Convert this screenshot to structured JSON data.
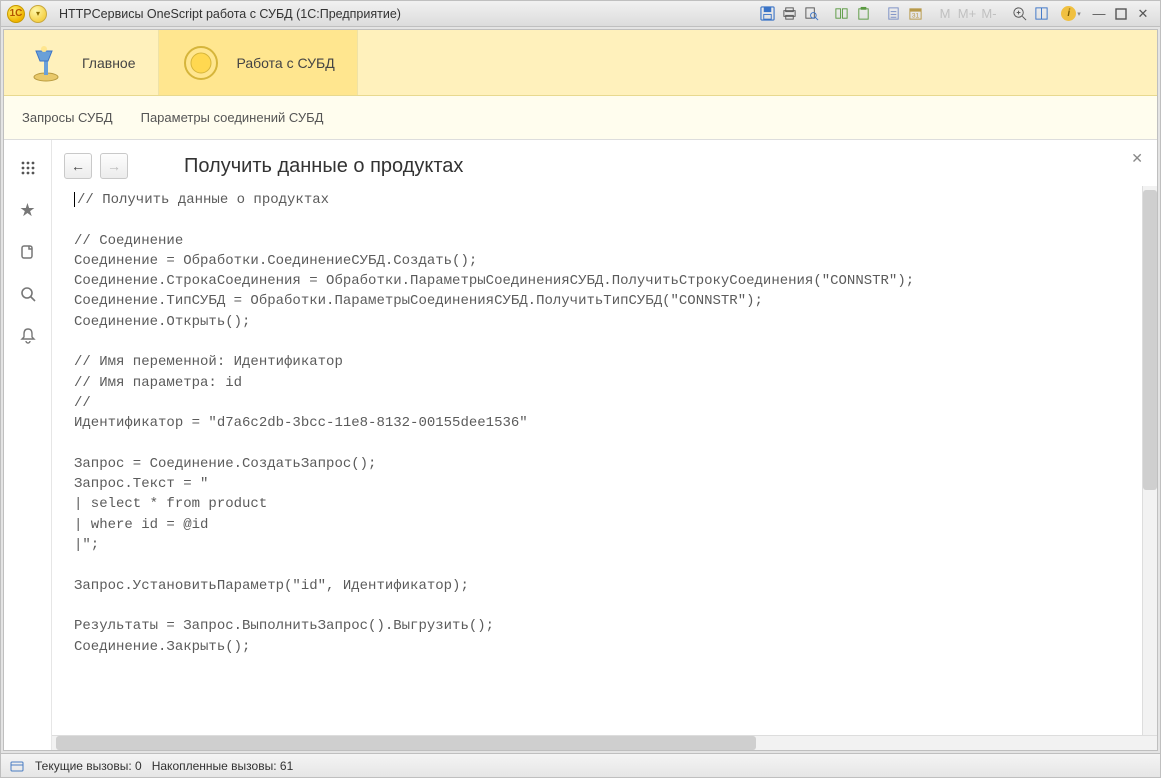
{
  "titlebar": {
    "title": "HTTPСервисы OneScript работа с СУБД  (1С:Предприятие)",
    "logo_label": "1C",
    "m_labels": [
      "M",
      "M+",
      "M-"
    ]
  },
  "tabs": [
    {
      "label": "Главное",
      "active": false
    },
    {
      "label": "Работа с СУБД",
      "active": true
    }
  ],
  "subnav": [
    "Запросы СУБД",
    "Параметры соединений СУБД"
  ],
  "document": {
    "title": "Получить данные о продуктах"
  },
  "code": "// Получить данные о продуктах\n\n// Соединение\nСоединение = Обработки.СоединениеСУБД.Создать();\nСоединение.СтрокаСоединения = Обработки.ПараметрыСоединенияСУБД.ПолучитьСтрокуСоединения(\"CONNSTR\");\nСоединение.ТипСУБД = Обработки.ПараметрыСоединенияСУБД.ПолучитьТипСУБД(\"CONNSTR\");\nСоединение.Открыть();\n\n// Имя переменной: Идентификатор\n// Имя параметра: id\n//\nИдентификатор = \"d7a6c2db-3bcc-11e8-8132-00155dee1536\"\n\nЗапрос = Соединение.СоздатьЗапрос();\nЗапрос.Текст = \"\n| select * from product\n| where id = @id\n|\";\n\nЗапрос.УстановитьПараметр(\"id\", Идентификатор);\n\nРезультаты = Запрос.ВыполнитьЗапрос().Выгрузить();\nСоединение.Закрыть();",
  "status": {
    "current_label": "Текущие вызовы:",
    "current_value": "0",
    "accum_label": "Накопленные вызовы:",
    "accum_value": "61"
  }
}
